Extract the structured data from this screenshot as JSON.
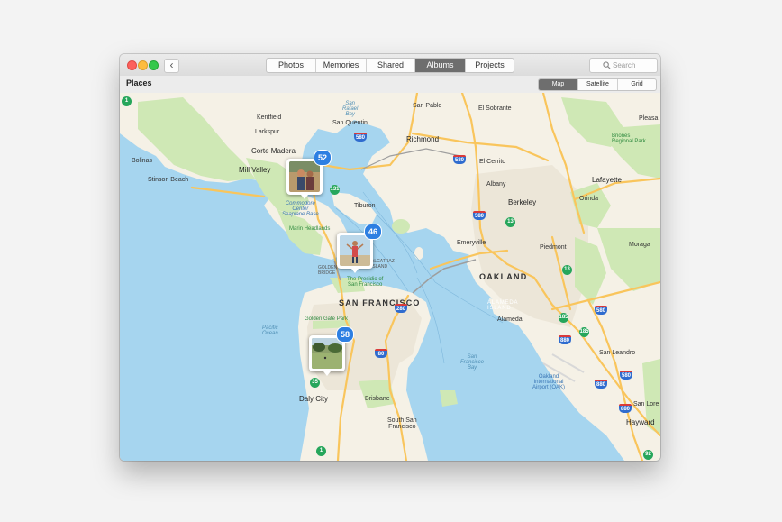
{
  "toolbar": {
    "back_label": "‹",
    "tabs": [
      {
        "label": "Photos",
        "active": false
      },
      {
        "label": "Memories",
        "active": false
      },
      {
        "label": "Shared",
        "active": false
      },
      {
        "label": "Albums",
        "active": true
      },
      {
        "label": "Projects",
        "active": false
      }
    ],
    "search_placeholder": "Search",
    "search_icon": "search-icon"
  },
  "subbar": {
    "title": "Places",
    "view_tabs": [
      {
        "label": "Map",
        "active": true
      },
      {
        "label": "Satellite",
        "active": false
      },
      {
        "label": "Grid",
        "active": false
      }
    ]
  },
  "map": {
    "labels": {
      "kentfield": "Kentfield",
      "larkspur": "Larkspur",
      "corte_madera": "Corte Madera",
      "mill_valley": "Mill Valley",
      "bolinas": "Bolinas",
      "stinson_beach": "Stinson Beach",
      "san_quentin": "San Quentin",
      "san_rafael_bay": "San\nRafael\nBay",
      "san_pablo": "San Pablo",
      "el_sobrante": "El Sobrante",
      "pleasa": "Pleasa",
      "richmond": "Richmond",
      "briones": "Briones\nRegional Park",
      "el_cerrito": "El Cerrito",
      "lafayette": "Lafayette",
      "albany": "Albany",
      "orinda": "Orinda",
      "berkeley": "Berkeley",
      "commodore": "Commodore\nCenter\nSeaplane Base",
      "tiburon": "Tiburon",
      "marin_headlands": "Marin Headlands",
      "emeryville": "Emeryville",
      "piedmont": "Piedmont",
      "moraga": "Moraga",
      "golden_gate_bridge": "GOLDEN GATE\nBRIDGE",
      "alcatraz": "ALCATRAZ\nISLAND",
      "presidio": "The Presidio of\nSan Francisco",
      "oakland": "OAKLAND",
      "san_francisco": "SAN FRANCISCO",
      "alameda_island": "ALAMEDA\nISLAND",
      "alameda": "Alameda",
      "golden_gate_park": "Golden Gate Park",
      "pacific_ocean": "Pacific\nOcean",
      "sf_bay": "San\nFrancisco\nBay",
      "san_leandro": "San Leandro",
      "oakland_airport": "Oakland\nInternational\nAirport (OAK)",
      "daly_city": "Daly City",
      "brisbane": "Brisbane",
      "south_sf": "South San\nFrancisco",
      "hayward": "Hayward",
      "san_lorenzo": "San Lore"
    },
    "shields": {
      "r1_top": "1",
      "r580_sq": "580",
      "r580_ec": "580",
      "r131": "131",
      "r580_b": "580",
      "r13_a": "13",
      "r13_b": "13",
      "r580_o": "580",
      "r185_a": "185",
      "r185_b": "185",
      "r880_a": "880",
      "r280": "280",
      "r80": "80",
      "r35": "35",
      "r880_b": "880",
      "r580_sl": "580",
      "r880_c": "880",
      "r1_bottom": "1",
      "r92": "92"
    },
    "clusters": [
      {
        "count": "52"
      },
      {
        "count": "46"
      },
      {
        "count": "58"
      }
    ]
  },
  "colors": {
    "water": "#a6d5ef",
    "land": "#f5f1e6",
    "park": "#cfe8b5",
    "urban": "#ece6d8",
    "highway": "#f9c55c",
    "accent": "#2d7fe2"
  }
}
